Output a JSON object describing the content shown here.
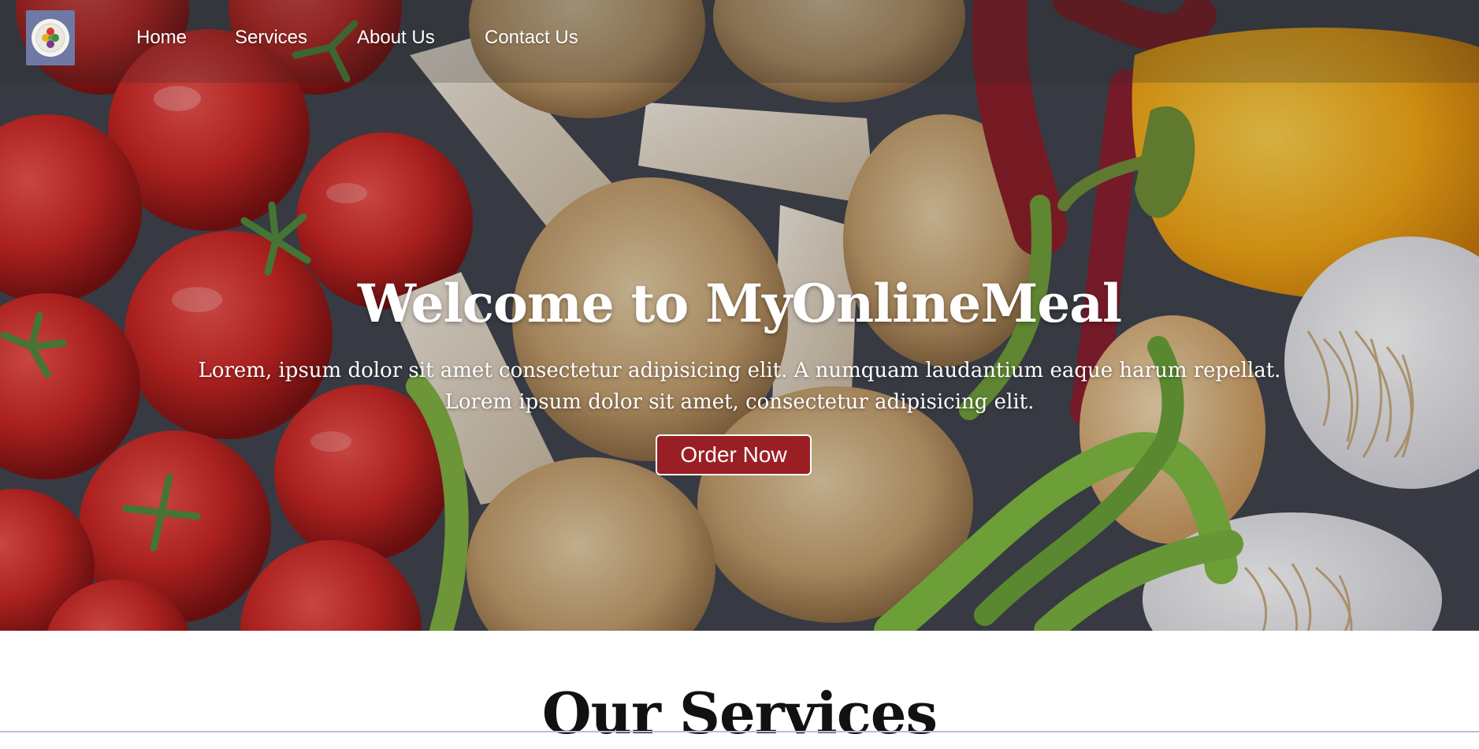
{
  "nav": {
    "logo_icon": "plate-with-vegetables-logo",
    "links": [
      "Home",
      "Services",
      "About Us",
      "Contact Us"
    ]
  },
  "hero": {
    "title": "Welcome to MyOnlineMeal",
    "subtitle_line1": "Lorem, ipsum dolor sit amet consectetur adipisicing elit. A numquam laudantium eaque harum repellat.",
    "subtitle_line2": "Lorem ipsum dolor sit amet, consectetur adipisicing elit.",
    "cta_label": "Order Now",
    "background_image": "vegetables-photo",
    "colors": {
      "cta": "#9a1f24",
      "text": "#ffffff"
    }
  },
  "services": {
    "title": "Our Services"
  }
}
